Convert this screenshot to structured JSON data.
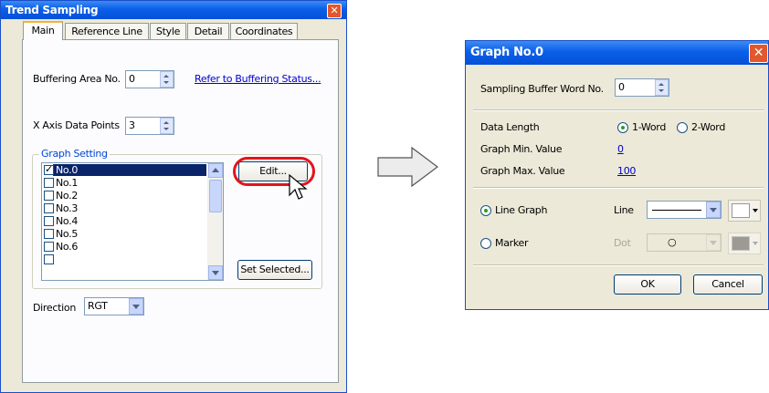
{
  "left_window": {
    "title": "Trend Sampling",
    "tabs": [
      {
        "label": "Main"
      },
      {
        "label": "Reference Line"
      },
      {
        "label": "Style"
      },
      {
        "label": "Detail"
      },
      {
        "label": "Coordinates"
      }
    ],
    "buffering_area_label": "Buffering Area No.",
    "buffering_area_value": "0",
    "buffering_status_link": "Refer to Buffering Status...",
    "x_axis_label": "X Axis Data Points",
    "x_axis_value": "3",
    "graph_setting_label": "Graph Setting",
    "graph_items": [
      {
        "label": "No.0",
        "checked": true,
        "selected": true
      },
      {
        "label": "No.1"
      },
      {
        "label": "No.2"
      },
      {
        "label": "No.3"
      },
      {
        "label": "No.4"
      },
      {
        "label": "No.5"
      },
      {
        "label": "No.6"
      }
    ],
    "edit_button": "Edit...",
    "set_selected_button": "Set Selected...",
    "direction_label": "Direction",
    "direction_value": "RGT"
  },
  "right_window": {
    "title": "Graph No.0",
    "sampling_buffer_label": "Sampling Buffer Word No.",
    "sampling_buffer_value": "0",
    "data_length_label": "Data Length",
    "data_length_options": [
      {
        "label": "1-Word",
        "selected": true
      },
      {
        "label": "2-Word",
        "selected": false
      }
    ],
    "min_label": "Graph Min. Value",
    "min_value": "0",
    "max_label": "Graph Max. Value",
    "max_value": "100",
    "line_graph_label": "Line Graph",
    "line_label": "Line",
    "marker_label": "Marker",
    "dot_label": "Dot",
    "dot_symbol": "○",
    "ok_button": "OK",
    "cancel_button": "Cancel"
  },
  "colors": {
    "title_bar": "#0a5fe8",
    "window_bg": "#ece9d8",
    "highlight_circle": "#e3141c",
    "selection": "#0a246a"
  },
  "icons": [
    "close-icon",
    "spin-up-icon",
    "spin-down-icon",
    "dropdown-arrow-icon",
    "arrow-right-icon",
    "mouse-cursor-icon",
    "checkbox-icon",
    "radio-icon"
  ]
}
